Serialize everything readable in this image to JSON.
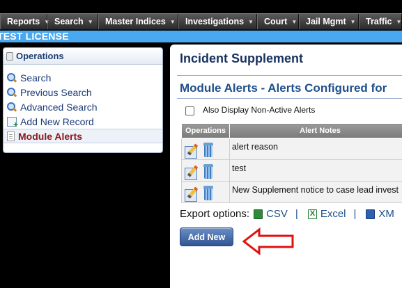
{
  "nav": {
    "items": [
      "Reports",
      "Search",
      "Master Indices",
      "Investigations",
      "Court",
      "Jail Mgmt",
      "Traffic"
    ]
  },
  "license_bar": "TEST LICENSE",
  "sidebar": {
    "title": "Operations",
    "items": [
      {
        "label": "Search",
        "icon": "magnifier-icon"
      },
      {
        "label": "Previous Search",
        "icon": "magnifier-icon"
      },
      {
        "label": "Advanced Search",
        "icon": "magnifier-icon"
      },
      {
        "label": "Add New Record",
        "icon": "add-record-icon"
      },
      {
        "label": "Module Alerts",
        "icon": "document-icon",
        "active": true
      }
    ]
  },
  "main": {
    "page_title": "Incident Supplement",
    "section_title": "Module Alerts - Alerts Configured for",
    "checkbox_label": "Also Display Non-Active Alerts",
    "table": {
      "headers": [
        "Operations",
        "Alert Notes"
      ],
      "rows": [
        {
          "note": "alert reason"
        },
        {
          "note": "test"
        },
        {
          "note": "New Supplement notice to case lead invest"
        }
      ]
    },
    "export": {
      "label": "Export options:",
      "options": [
        "CSV",
        "Excel",
        "XM"
      ],
      "separator": "|"
    },
    "add_new_label": "Add New"
  },
  "colors": {
    "license_bar": "#4aa8f0",
    "title": "#17305f",
    "section_title": "#1f4f8c",
    "active_item": "#8b1a1a",
    "arrow": "#e01010"
  }
}
